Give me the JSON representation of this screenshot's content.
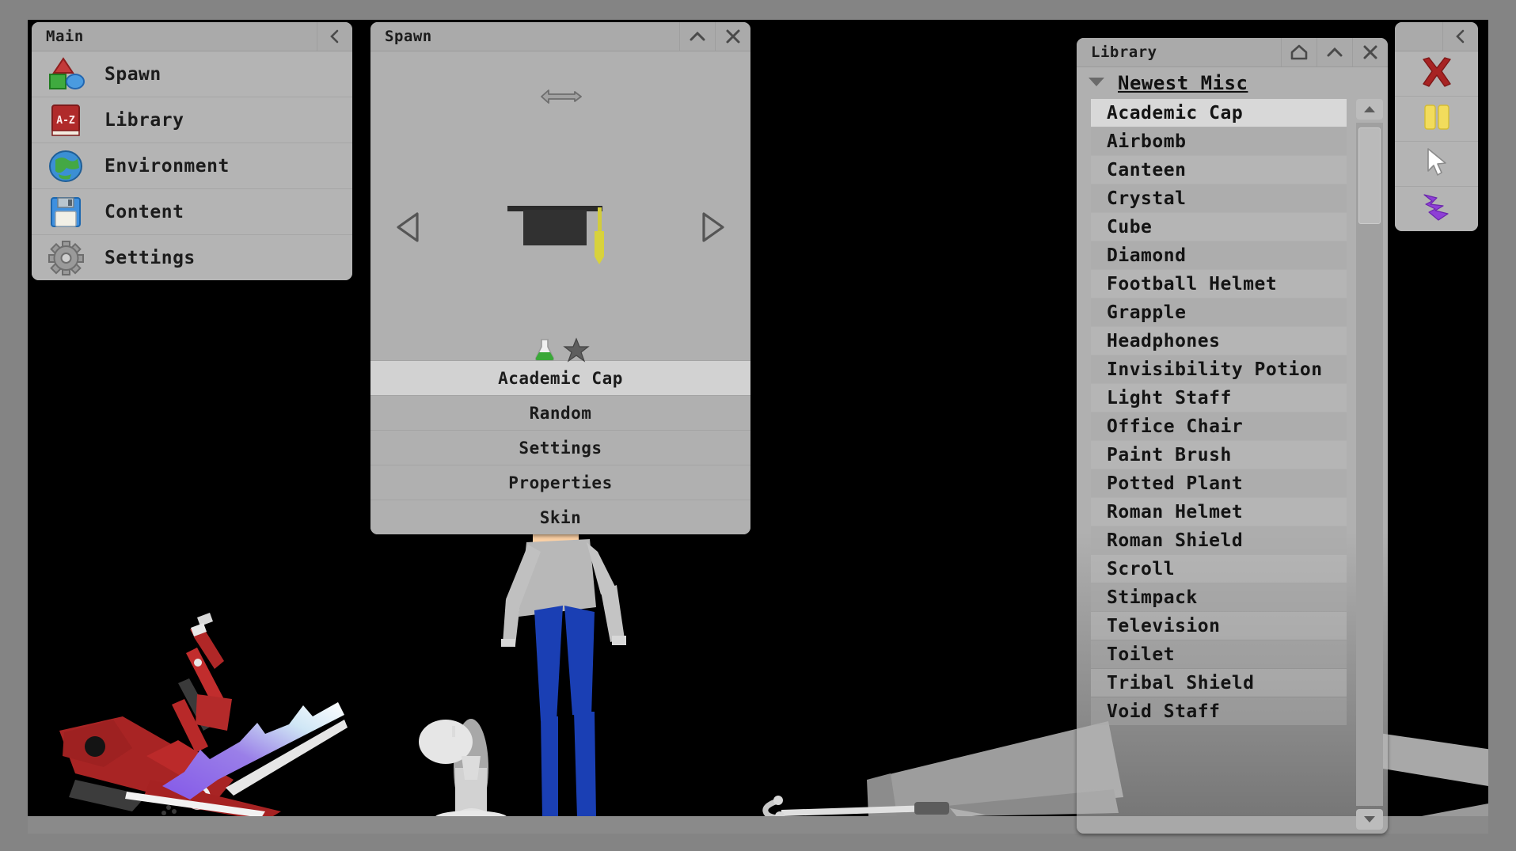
{
  "window": {
    "background_color": "#848484",
    "viewport_color": "#000000",
    "ground_color": "#8a8a8a"
  },
  "main_panel": {
    "title": "Main",
    "collapse_label": "<",
    "items": [
      {
        "label": "Spawn",
        "icon": "shapes-icon"
      },
      {
        "label": "Library",
        "icon": "book-az-icon"
      },
      {
        "label": "Environment",
        "icon": "globe-icon"
      },
      {
        "label": "Content",
        "icon": "floppy-disk-icon"
      },
      {
        "label": "Settings",
        "icon": "gear-icon"
      }
    ]
  },
  "spawn_panel": {
    "title": "Spawn",
    "collapse_label": "^",
    "close_label": "X",
    "preview_item": "Academic Cap",
    "flip_icon": "flip-horizontal-icon",
    "prev_icon": "arrow-left-icon",
    "next_icon": "arrow-right-icon",
    "badges": [
      "flask-icon",
      "star-icon"
    ],
    "buttons": [
      {
        "label": "Academic Cap",
        "selected": true
      },
      {
        "label": "Random",
        "selected": false
      },
      {
        "label": "Settings",
        "selected": false
      },
      {
        "label": "Properties",
        "selected": false
      },
      {
        "label": "Skin",
        "selected": false
      }
    ]
  },
  "library_panel": {
    "title": "Library",
    "home_label": "home-icon",
    "collapse_label": "^",
    "close_label": "X",
    "group": {
      "label": "Newest Misc",
      "expanded": true
    },
    "items": [
      {
        "label": "Academic Cap",
        "selected": true
      },
      {
        "label": "Airbomb",
        "selected": false
      },
      {
        "label": "Canteen",
        "selected": false
      },
      {
        "label": "Crystal",
        "selected": false
      },
      {
        "label": "Cube",
        "selected": false
      },
      {
        "label": "Diamond",
        "selected": false
      },
      {
        "label": "Football Helmet",
        "selected": false
      },
      {
        "label": "Grapple",
        "selected": false
      },
      {
        "label": "Headphones",
        "selected": false
      },
      {
        "label": "Invisibility Potion",
        "selected": false
      },
      {
        "label": "Light Staff",
        "selected": false
      },
      {
        "label": "Office Chair",
        "selected": false
      },
      {
        "label": "Paint Brush",
        "selected": false
      },
      {
        "label": "Potted Plant",
        "selected": false
      },
      {
        "label": "Roman Helmet",
        "selected": false
      },
      {
        "label": "Roman Shield",
        "selected": false
      },
      {
        "label": "Scroll",
        "selected": false
      },
      {
        "label": "Stimpack",
        "selected": false
      },
      {
        "label": "Television",
        "selected": false
      },
      {
        "label": "Toilet",
        "selected": false
      },
      {
        "label": "Tribal Shield",
        "selected": false
      },
      {
        "label": "Void Staff",
        "selected": false
      }
    ]
  },
  "tool_panel": {
    "collapse_label": "<",
    "tools": [
      {
        "icon": "red-x-icon",
        "color": "#a02020"
      },
      {
        "icon": "pause-bars-icon",
        "color": "#f0dc55"
      },
      {
        "icon": "cursor-select-icon",
        "color": "#ffffff"
      },
      {
        "icon": "lightning-bolt-icon",
        "color": "#8e3fd6"
      }
    ]
  },
  "scene": {
    "objects": [
      {
        "name": "red-scooter",
        "color": "#b02020"
      },
      {
        "name": "light-staff",
        "color": "#9b7ae0"
      },
      {
        "name": "pedestal-fan",
        "color": "#d8d8d8"
      },
      {
        "name": "ragdoll-character",
        "shirt_color": "#b4b4b4",
        "pants_color": "#1a3fb4",
        "skin_color": "#fbd0a4",
        "cap_color": "#2c2c2c",
        "tassel_color": "#d8d040"
      },
      {
        "name": "television",
        "color": "#9a9a9a"
      }
    ]
  }
}
